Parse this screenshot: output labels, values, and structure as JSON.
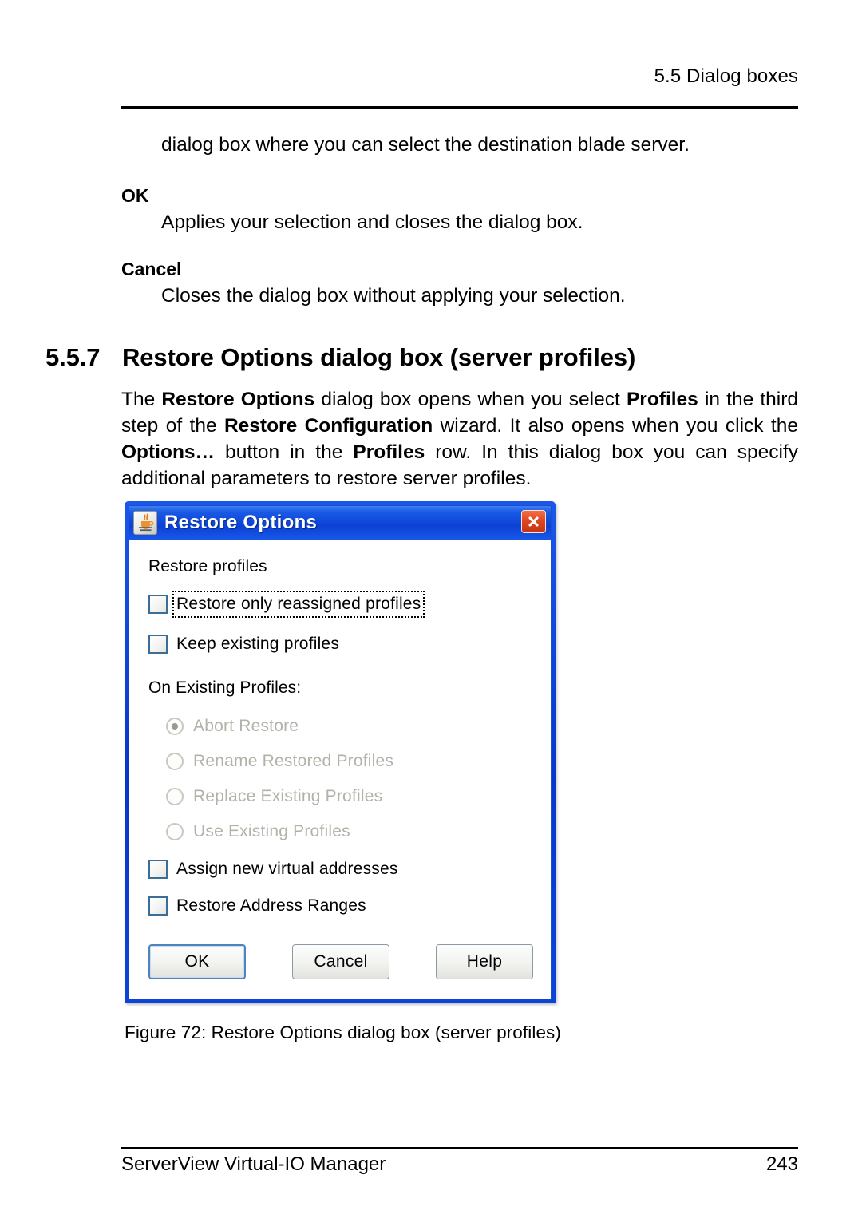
{
  "page": {
    "running_header": "5.5 Dialog boxes",
    "intro_line": "dialog box where you can select the destination blade server."
  },
  "definitions": [
    {
      "term": "OK",
      "description": "Applies your selection and closes the dialog box."
    },
    {
      "term": "Cancel",
      "description": "Closes the dialog box without applying your selection."
    }
  ],
  "section": {
    "number": "5.5.7",
    "title": "Restore Options dialog box (server profiles)",
    "paragraph": {
      "part1": "The ",
      "bold1": "Restore Options",
      "part2": " dialog box opens when you select ",
      "bold2": "Profiles",
      "part3": " in the third step of the ",
      "bold3": "Restore Configuration",
      "part4": " wizard. It also opens when you click the ",
      "bold4": "Options…",
      "part5": " button in the ",
      "bold5": "Profiles",
      "part6": " row. In this dialog box you can specify additional parameters to restore server profiles."
    }
  },
  "dialog": {
    "title": "Restore Options",
    "icon": "java-coffee-cup-icon",
    "close_icon": "close-icon",
    "group_label_profiles": "Restore profiles",
    "checkboxes_top": [
      {
        "label": "Restore only reassigned profiles",
        "checked": false,
        "focused": true
      },
      {
        "label": "Keep existing profiles",
        "checked": false,
        "focused": false
      }
    ],
    "group_label_existing": "On Existing Profiles:",
    "radios": [
      {
        "label": "Abort Restore",
        "selected": true,
        "disabled": true
      },
      {
        "label": "Rename Restored Profiles",
        "selected": false,
        "disabled": true
      },
      {
        "label": "Replace Existing Profiles",
        "selected": false,
        "disabled": true
      },
      {
        "label": "Use Existing Profiles",
        "selected": false,
        "disabled": true
      }
    ],
    "checkboxes_bottom": [
      {
        "label": "Assign new virtual addresses",
        "checked": false
      },
      {
        "label": "Restore Address Ranges",
        "checked": false
      }
    ],
    "buttons": [
      {
        "label": "OK",
        "default": true
      },
      {
        "label": "Cancel",
        "default": false
      },
      {
        "label": "Help",
        "default": false
      }
    ]
  },
  "figure": {
    "caption": "Figure 72: Restore Options dialog box (server profiles)"
  },
  "footer": {
    "left": "ServerView Virtual-IO Manager",
    "right": "243"
  },
  "colors": {
    "title_bar_blue": "#0b41d4",
    "dialog_border_blue": "#0a3fd6",
    "close_red": "#de4822",
    "checkbox_border": "#3a6e98",
    "disabled_text": "#b3b2a9",
    "default_button_ring": "#4f83bd"
  }
}
